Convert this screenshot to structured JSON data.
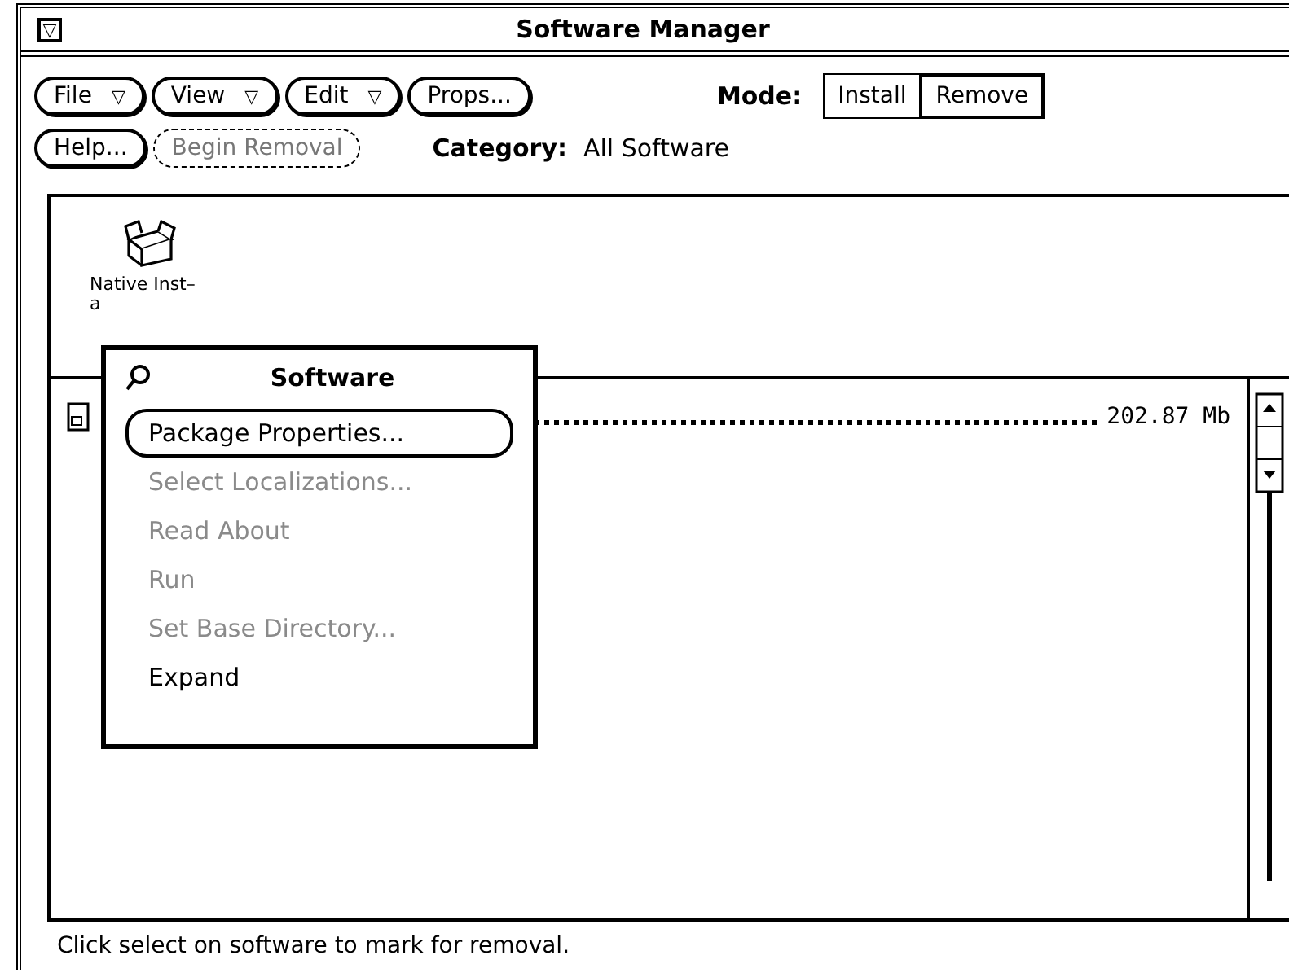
{
  "window": {
    "title": "Software Manager",
    "menu_glyph": "▽"
  },
  "controls": [
    {
      "label": "File",
      "menu": true,
      "disabled": false
    },
    {
      "label": "View",
      "menu": true,
      "disabled": false
    },
    {
      "label": "Edit",
      "menu": true,
      "disabled": false
    },
    {
      "label": "Props...",
      "menu": false,
      "disabled": false
    }
  ],
  "controls_row_2": [
    {
      "label": "Help...",
      "menu": false,
      "disabled": false
    },
    {
      "label": "Begin Removal",
      "menu": false,
      "disabled": true
    }
  ],
  "menu_glyph": "▽",
  "mode": {
    "label": "Mode:",
    "options": [
      {
        "label": "Install",
        "selected": false
      },
      {
        "label": "Remove",
        "selected": true
      }
    ]
  },
  "category": {
    "label": "Category:",
    "value": "All Software"
  },
  "icon_pane": {
    "items": [
      {
        "lines": [
          "Native Inst–",
          "a"
        ]
      }
    ]
  },
  "list": {
    "rows": [
      {
        "size": "202.87 Mb"
      }
    ]
  },
  "popup_menu": {
    "title": "Software",
    "items": [
      {
        "label": "Package Properties...",
        "default": true,
        "disabled": false
      },
      {
        "label": "Select Localizations...",
        "default": false,
        "disabled": true
      },
      {
        "label": "Read About",
        "default": false,
        "disabled": true
      },
      {
        "label": "Run",
        "default": false,
        "disabled": true
      },
      {
        "label": "Set Base Directory...",
        "default": false,
        "disabled": true
      },
      {
        "label": "Expand",
        "default": false,
        "disabled": false
      }
    ]
  },
  "status_bar": {
    "text": "Click select on software to mark for removal."
  }
}
